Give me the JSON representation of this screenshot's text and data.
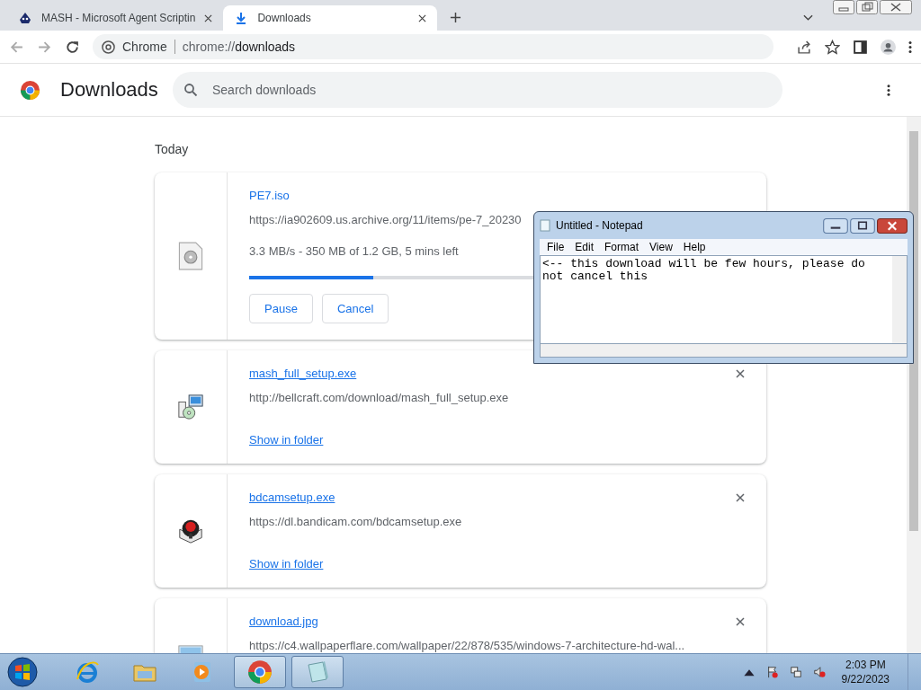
{
  "tabs": [
    {
      "title": "MASH - Microsoft Agent Scriptin",
      "selected": false
    },
    {
      "title": "Downloads",
      "selected": true
    }
  ],
  "omnibox": {
    "site_label": "Chrome",
    "url_prefix": "chrome://",
    "url_path": "downloads"
  },
  "header": {
    "title": "Downloads",
    "search_placeholder": "Search downloads"
  },
  "date_heading": "Today",
  "downloads": [
    {
      "kind": "in_progress",
      "file_name": "PE7.iso",
      "url": "https://ia902609.us.archive.org/11/items/pe-7_20230",
      "status": "3.3 MB/s - 350 MB of 1.2 GB, 5 mins left",
      "level": 0.25,
      "buttons": [
        "Pause",
        "Cancel"
      ]
    },
    {
      "kind": "complete",
      "file_name": "mash_full_setup.exe",
      "url": "http://bellcraft.com/download/mash_full_setup.exe",
      "link": "Show in folder",
      "removable": true
    },
    {
      "kind": "complete",
      "file_name": "bdcamsetup.exe",
      "url": "https://dl.bandicam.com/bdcamsetup.exe",
      "link": "Show in folder",
      "removable": true
    },
    {
      "kind": "cut",
      "file_name": "download.jpg",
      "url": "https://c4.wallpaperflare.com/wallpaper/22/878/535/windows-7-architecture-hd-wal...",
      "removable": true
    }
  ],
  "notepad": {
    "title": "Untitled - Notepad",
    "menu": [
      "File",
      "Edit",
      "Format",
      "View",
      "Help"
    ],
    "text": "<-- this download will be few hours, please do not cancel this"
  },
  "taskbar": {
    "apps": [
      {
        "active": false
      },
      {
        "active": false
      },
      {
        "active": false
      },
      {
        "active": true
      },
      {
        "active": true
      }
    ],
    "time": "2:03 PM",
    "date": "9/22/2023"
  }
}
